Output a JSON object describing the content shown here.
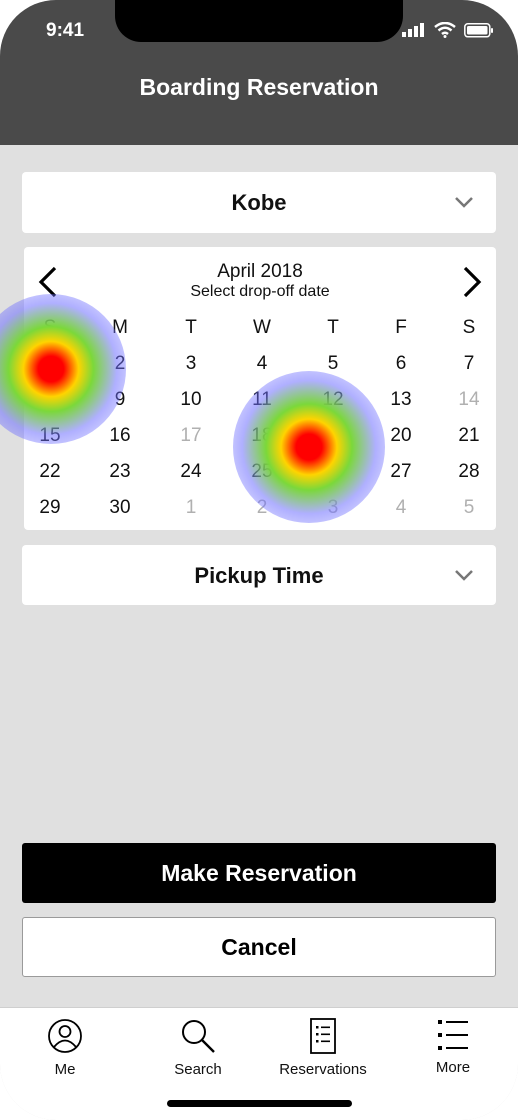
{
  "status_bar": {
    "time": "9:41"
  },
  "header": {
    "title": "Boarding Reservation"
  },
  "location_select": {
    "value": "Kobe"
  },
  "calendar": {
    "month": "April 2018",
    "subtitle": "Select drop-off date",
    "weekdays": [
      "S",
      "M",
      "T",
      "W",
      "T",
      "F",
      "S"
    ],
    "weeks": [
      [
        {
          "d": "1",
          "m": false
        },
        {
          "d": "2",
          "m": false
        },
        {
          "d": "3",
          "m": false
        },
        {
          "d": "4",
          "m": false
        },
        {
          "d": "5",
          "m": false
        },
        {
          "d": "6",
          "m": false
        },
        {
          "d": "7",
          "m": false
        }
      ],
      [
        {
          "d": "8",
          "m": false
        },
        {
          "d": "9",
          "m": false
        },
        {
          "d": "10",
          "m": false
        },
        {
          "d": "11",
          "m": false
        },
        {
          "d": "12",
          "m": false
        },
        {
          "d": "13",
          "m": false
        },
        {
          "d": "14",
          "m": true
        }
      ],
      [
        {
          "d": "15",
          "m": false
        },
        {
          "d": "16",
          "m": false
        },
        {
          "d": "17",
          "m": true
        },
        {
          "d": "18",
          "m": false
        },
        {
          "d": "19",
          "m": false
        },
        {
          "d": "20",
          "m": false
        },
        {
          "d": "21",
          "m": false
        }
      ],
      [
        {
          "d": "22",
          "m": false
        },
        {
          "d": "23",
          "m": false
        },
        {
          "d": "24",
          "m": false
        },
        {
          "d": "25",
          "m": false
        },
        {
          "d": "26",
          "m": false
        },
        {
          "d": "27",
          "m": false
        },
        {
          "d": "28",
          "m": false
        }
      ],
      [
        {
          "d": "29",
          "m": false
        },
        {
          "d": "30",
          "m": false
        },
        {
          "d": "1",
          "m": true
        },
        {
          "d": "2",
          "m": true
        },
        {
          "d": "3",
          "m": true
        },
        {
          "d": "4",
          "m": true
        },
        {
          "d": "5",
          "m": true
        }
      ]
    ]
  },
  "pickup_select": {
    "value": "Pickup Time"
  },
  "actions": {
    "primary": "Make Reservation",
    "secondary": "Cancel"
  },
  "tabbar": {
    "items": [
      {
        "label": "Me",
        "icon": "person-icon"
      },
      {
        "label": "Search",
        "icon": "magnifier-icon"
      },
      {
        "label": "Reservations",
        "icon": "list-document-icon"
      },
      {
        "label": "More",
        "icon": "more-list-icon"
      }
    ]
  },
  "colors": {
    "header_bg": "#4a4a4a",
    "page_bg": "#e0e0e0",
    "primary_button": "#000000"
  }
}
